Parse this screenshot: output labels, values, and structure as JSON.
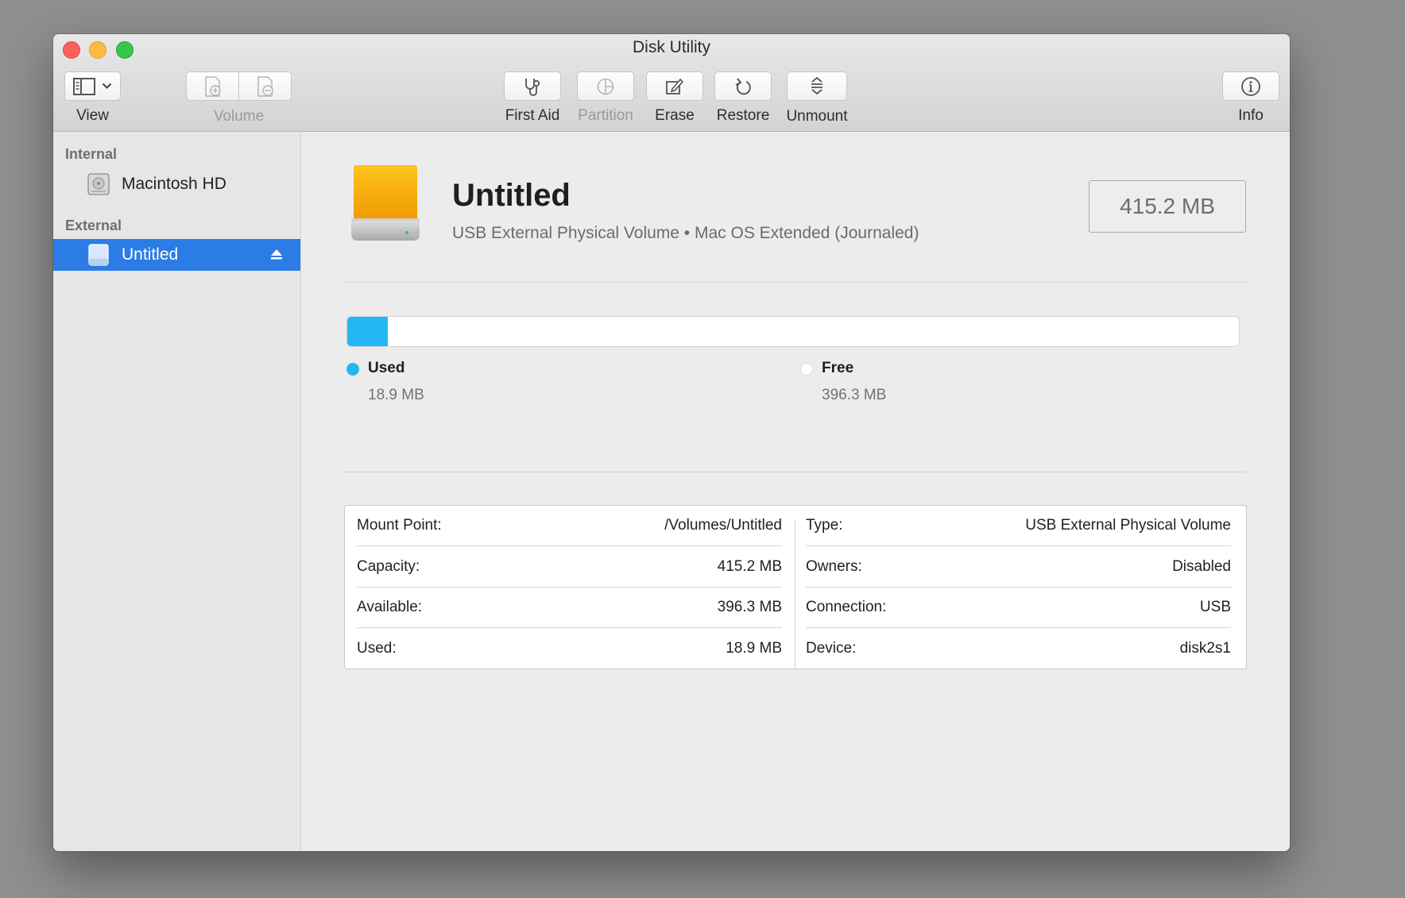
{
  "window": {
    "title": "Disk Utility"
  },
  "toolbar": {
    "view_label": "View",
    "volume_label": "Volume",
    "first_aid_label": "First Aid",
    "partition_label": "Partition",
    "erase_label": "Erase",
    "restore_label": "Restore",
    "unmount_label": "Unmount",
    "info_label": "Info"
  },
  "sidebar": {
    "internal_header": "Internal",
    "external_header": "External",
    "internal_items": [
      {
        "label": "Macintosh HD",
        "icon": "internal-disk-icon"
      }
    ],
    "external_items": [
      {
        "label": "Untitled",
        "icon": "external-disk-icon",
        "selected": true
      }
    ]
  },
  "volume": {
    "name": "Untitled",
    "subtitle": "USB External Physical Volume • Mac OS Extended (Journaled)",
    "size": "415.2 MB",
    "icon": "usb-drive-icon"
  },
  "usage": {
    "used_fraction": 0.0455,
    "used_title": "Used",
    "used_value": "18.9 MB",
    "free_title": "Free",
    "free_value": "396.3 MB",
    "used_color": "#23b7f4",
    "free_color": "#ffffff"
  },
  "info": {
    "left": [
      {
        "label": "Mount Point:",
        "value": "/Volumes/Untitled"
      },
      {
        "label": "Capacity:",
        "value": "415.2 MB"
      },
      {
        "label": "Available:",
        "value": "396.3 MB"
      },
      {
        "label": "Used:",
        "value": "18.9 MB"
      }
    ],
    "right": [
      {
        "label": "Type:",
        "value": "USB External Physical Volume"
      },
      {
        "label": "Owners:",
        "value": "Disabled"
      },
      {
        "label": "Connection:",
        "value": "USB"
      },
      {
        "label": "Device:",
        "value": "disk2s1"
      }
    ]
  },
  "colors": {
    "selection": "#2c7ce6",
    "accent": "#23b7f4"
  }
}
